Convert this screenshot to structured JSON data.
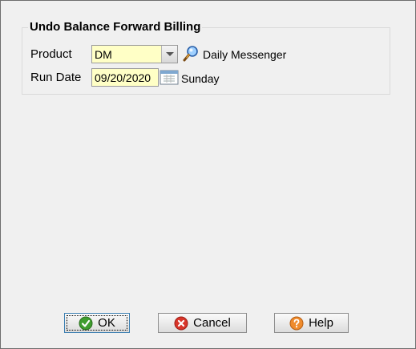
{
  "dialog": {
    "group_title": "Undo Balance Forward Billing",
    "fields": {
      "product": {
        "label": "Product",
        "value": "DM",
        "description": "Daily Messenger"
      },
      "run_date": {
        "label": "Run Date",
        "value": "09/20/2020",
        "day_of_week": "Sunday"
      }
    },
    "field_background": "#ffffc6"
  },
  "buttons": {
    "ok": "OK",
    "cancel": "Cancel",
    "help": "Help"
  },
  "icons": {
    "product_lookup": "search-icon",
    "calendar": "calendar-icon",
    "ok": "check-icon",
    "cancel": "cancel-icon",
    "help": "help-icon"
  }
}
